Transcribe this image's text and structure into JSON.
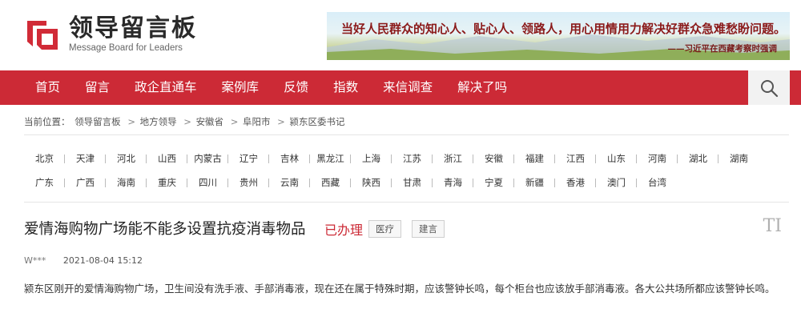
{
  "header": {
    "logo_title": "领导留言板",
    "logo_subtitle": "Message Board for Leaders",
    "banner_quote": "当好人民群众的知心人、贴心人、领路人，用心用情用力解决好群众急难愁盼问题。",
    "banner_source": "——习近平在西藏考察时强调"
  },
  "nav": {
    "items": [
      "首页",
      "留言",
      "政企直通车",
      "案例库",
      "反馈",
      "指数",
      "来信调查",
      "解决了吗"
    ],
    "search_icon": "search-icon"
  },
  "breadcrumb": {
    "label": "当前位置：",
    "items": [
      "领导留言板",
      "地方领导",
      "安徽省",
      "阜阳市",
      "颍东区委书记"
    ],
    "separator": ">"
  },
  "regions": {
    "row1": [
      "北京",
      "天津",
      "河北",
      "山西",
      "内蒙古",
      "辽宁",
      "吉林",
      "黑龙江",
      "上海",
      "江苏",
      "浙江",
      "安徽",
      "福建",
      "江西",
      "山东",
      "河南",
      "湖北",
      "湖南"
    ],
    "row2": [
      "广东",
      "广西",
      "海南",
      "重庆",
      "四川",
      "贵州",
      "云南",
      "西藏",
      "陕西",
      "甘肃",
      "青海",
      "宁夏",
      "新疆",
      "香港",
      "澳门",
      "台湾"
    ]
  },
  "article": {
    "title": "爱情海购物广场能不能多设置抗疫消毒物品",
    "status": "已办理",
    "tags": [
      "医疗",
      "建言"
    ],
    "font_toggle": "TI",
    "author": "W***",
    "date": "2021-08-04 15:12",
    "content": "颍东区刚开的爱情海购物广场，卫生间没有洗手液、手部消毒液，现在还在属于特殊时期，应该警钟长鸣，每个柜台也应该放手部消毒液。各大公共场所都应该警钟长鸣。"
  },
  "colors": {
    "brand_red": "#cc2a36",
    "status_red": "#cc2a36"
  }
}
